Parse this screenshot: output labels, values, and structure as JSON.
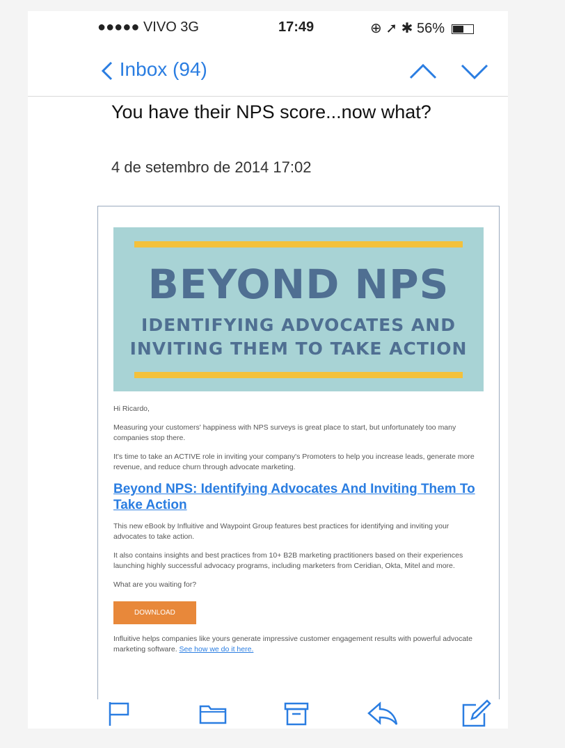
{
  "status": {
    "carrier": "●●●●● VIVO  3G",
    "time": "17:49",
    "indicators": "⊕ ➚ ✱ 56%"
  },
  "nav": {
    "back_label": "Inbox (94)"
  },
  "email": {
    "subject": "You have their NPS score...now what?",
    "date": "4 de setembro de 2014 17:02"
  },
  "banner": {
    "title": "BEYOND NPS",
    "subtitle_line1": "IDENTIFYING ADVOCATES AND",
    "subtitle_line2": "INVITING THEM TO TAKE ACTION"
  },
  "body": {
    "greeting": "Hi Ricardo,",
    "p1": "Measuring your customers' happiness with NPS surveys is great place to start, but unfortunately too many companies stop there.",
    "p2": "It's time to take an ACTIVE role in inviting your company's Promoters to help you increase leads, generate more revenue, and reduce churn through advocate marketing.",
    "link_title": "Beyond NPS: Identifying Advocates And Inviting Them To Take Action",
    "p3": "This new eBook by Influitive and Waypoint Group features best practices for identifying and inviting your advocates to take action.",
    "p4": "It also contains insights and best practices from 10+ B2B marketing practitioners based on their experiences launching highly successful advocacy programs, including marketers from Ceridian, Okta, Mitel and more.",
    "p5": "What are you waiting for?",
    "download_label": "DOWNLOAD",
    "p6": "Influitive helps companies like yours generate impressive customer engagement results with powerful advocate marketing software.",
    "p6_link": "See how we do it here."
  },
  "colors": {
    "accent": "#2a7de1",
    "banner_bg": "#a8d3d5",
    "banner_text": "#4f6f92",
    "bar": "#f3c13b",
    "button": "#e8883a"
  },
  "toolbar_icons": [
    "flag-icon",
    "folder-icon",
    "archive-icon",
    "reply-icon",
    "compose-icon"
  ]
}
